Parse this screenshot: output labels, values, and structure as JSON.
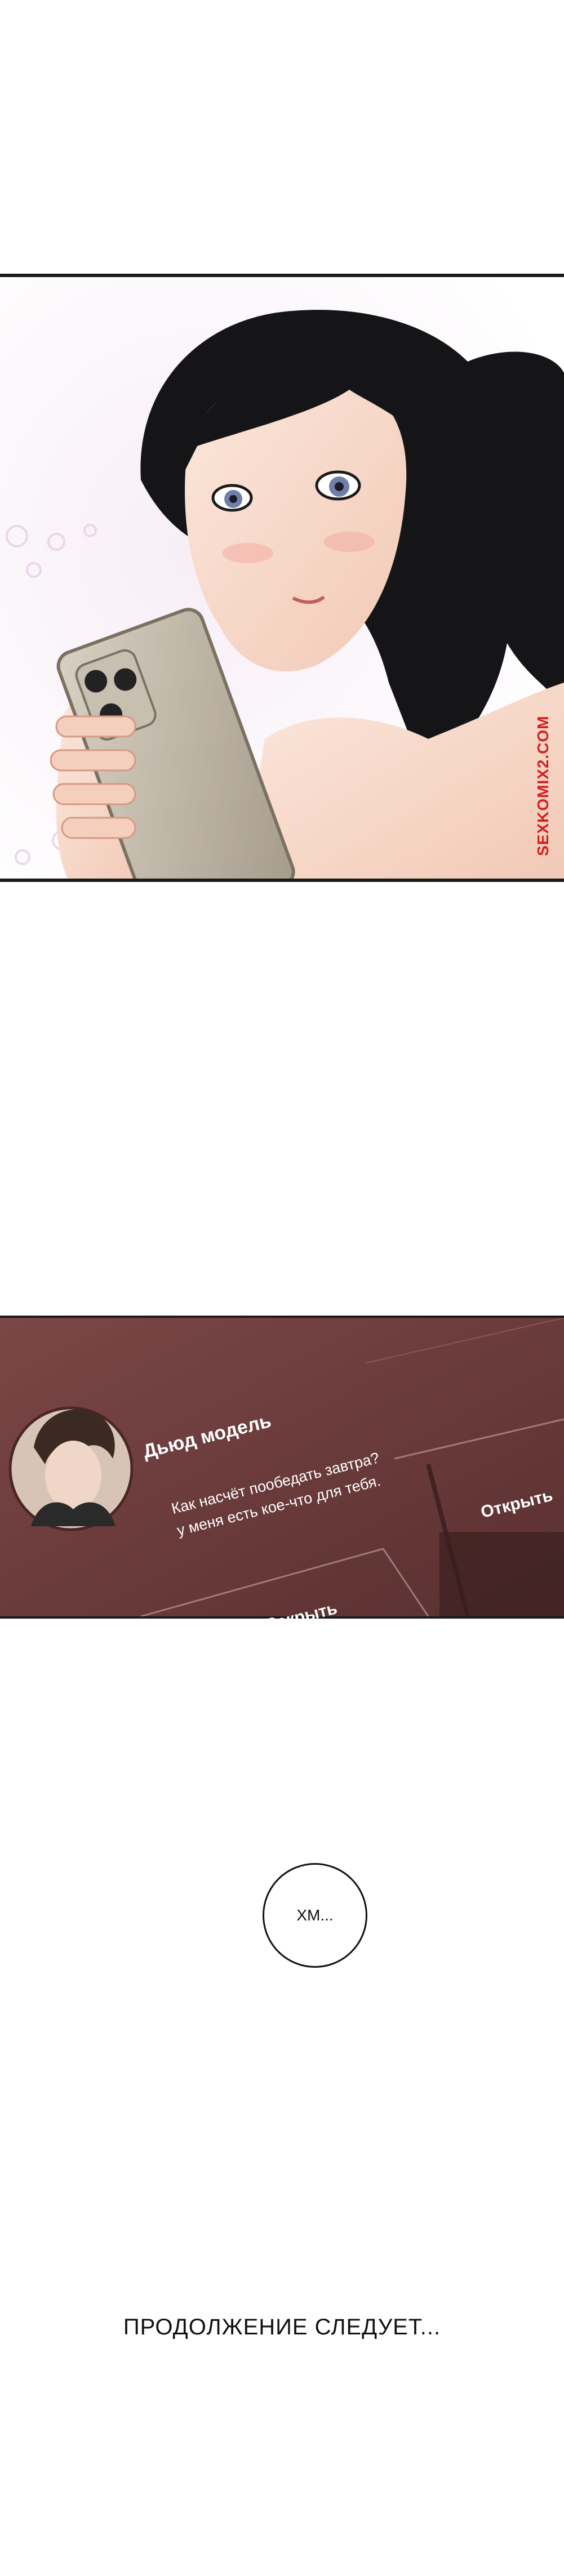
{
  "watermark": "SEXKOMIX2.COM",
  "notification": {
    "sender": "Дьюд модель",
    "message_line1": "Как насчёт пообедать завтра?",
    "message_line2": "у меня есть кое-что для тебя.",
    "open_label": "Открыть",
    "close_label": "Закрыть"
  },
  "bubble_text": "ХМ...",
  "continued_text": "ПРОДОЛЖЕНИЕ СЛЕДУЕТ..."
}
